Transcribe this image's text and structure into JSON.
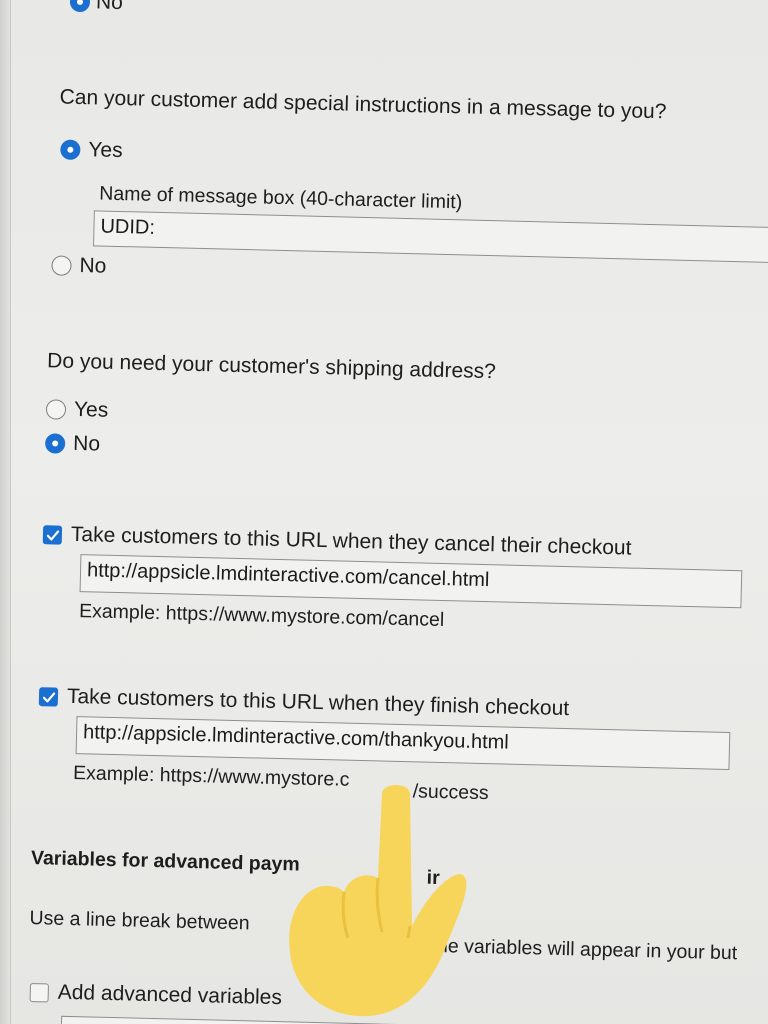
{
  "top_option": {
    "label": "No"
  },
  "special_instructions": {
    "question": "Can your customer add special instructions in a message to you?",
    "yes_label": "Yes",
    "no_label": "No",
    "selected": "Yes",
    "message_box_label": "Name of message box (40-character limit)",
    "message_box_value": "UDID:"
  },
  "shipping": {
    "question": "Do you need your customer's shipping address?",
    "yes_label": "Yes",
    "no_label": "No",
    "selected": "No"
  },
  "cancel_url": {
    "checked": true,
    "label": "Take customers to this URL when they cancel their checkout",
    "value": "http://appsicle.lmdinteractive.com/cancel.html",
    "example": "Example: https://www.mystore.com/cancel"
  },
  "finish_url": {
    "checked": true,
    "label": "Take customers to this URL when they finish checkout",
    "value": "http://appsicle.lmdinteractive.com/thankyou.html",
    "example_visible_left": "Example: https://www.mystore.c",
    "example_visible_right": "/success"
  },
  "advanced": {
    "heading_visible_left": "Variables for advanced paym",
    "heading_visible_right": "ir",
    "description_visible_left": "Use a line break between",
    "description_visible_right": "ne variables will appear in your but",
    "checkbox_label": "Add advanced variables",
    "checked": false
  },
  "colors": {
    "accent": "#1b6fd1",
    "background": "#ececea",
    "text": "#1e1e1e",
    "finger_overlay": "#f7d55a"
  },
  "icons": [
    "radio-selected-icon",
    "radio-unselected-icon",
    "checkbox-checked-icon",
    "checkbox-unchecked-icon",
    "pointing-finger-emoji"
  ]
}
